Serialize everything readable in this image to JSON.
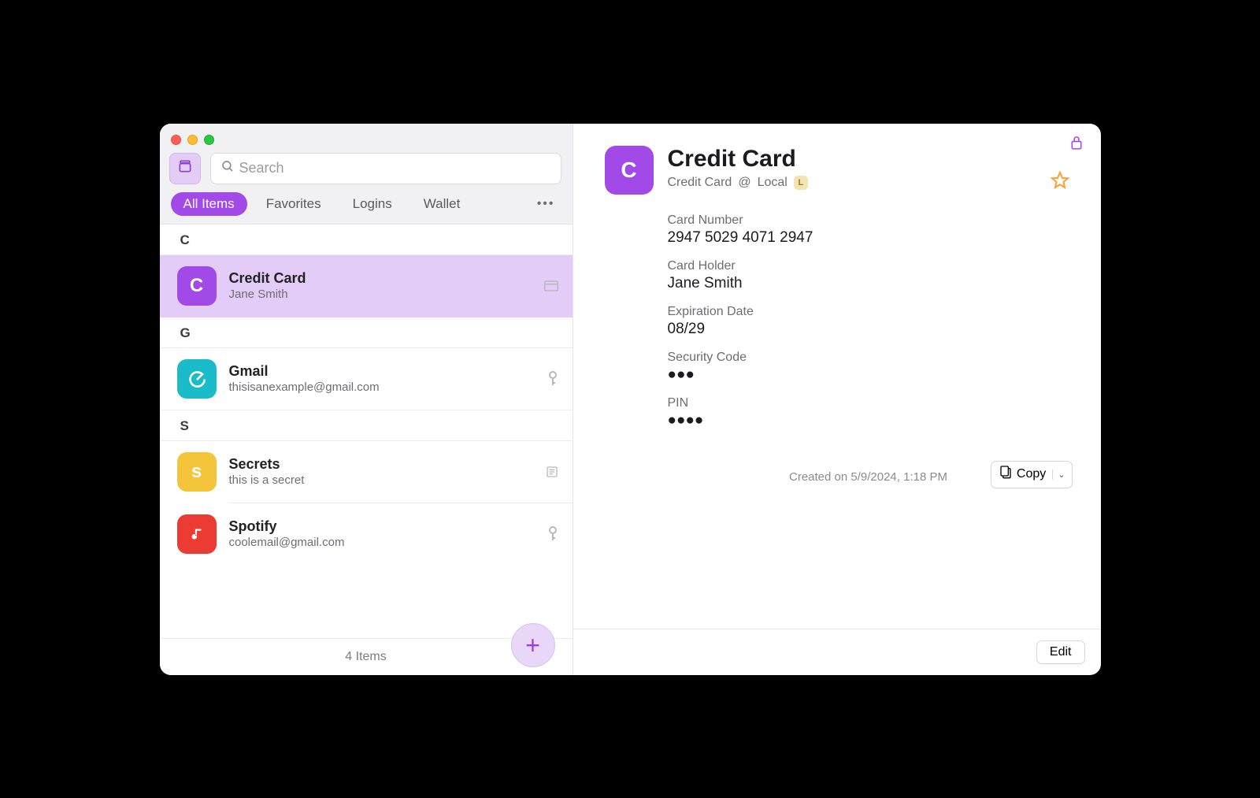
{
  "search": {
    "placeholder": "Search"
  },
  "tabs": {
    "all": "All Items",
    "favorites": "Favorites",
    "logins": "Logins",
    "wallet": "Wallet"
  },
  "sections": {
    "c": "C",
    "g": "G",
    "s": "S"
  },
  "items": {
    "credit_card": {
      "title": "Credit Card",
      "sub": "Jane Smith",
      "letter": "C",
      "color": "#a24ae8"
    },
    "gmail": {
      "title": "Gmail",
      "sub": "thisisanexample@gmail.com",
      "color": "#1abcca"
    },
    "secrets": {
      "title": "Secrets",
      "sub": "this is a secret",
      "letter": "s",
      "color": "#f4c53a"
    },
    "spotify": {
      "title": "Spotify",
      "sub": "coolemail@gmail.com",
      "color": "#ec3b33"
    }
  },
  "footer": {
    "count": "4 Items"
  },
  "detail": {
    "title": "Credit Card",
    "subtitle_type": "Credit Card",
    "subtitle_at": "@",
    "subtitle_vault": "Local",
    "vault_badge": "L",
    "icon_letter": "C",
    "fields": {
      "card_number_label": "Card Number",
      "card_number_value": "2947 5029 4071 2947",
      "card_holder_label": "Card Holder",
      "card_holder_value": "Jane Smith",
      "exp_label": "Expiration Date",
      "exp_value": "08/29",
      "sec_label": "Security Code",
      "sec_value": "●●●",
      "pin_label": "PIN",
      "pin_value": "●●●●"
    },
    "copy_label": "Copy",
    "created": "Created on 5/9/2024, 1:18 PM",
    "edit": "Edit"
  }
}
